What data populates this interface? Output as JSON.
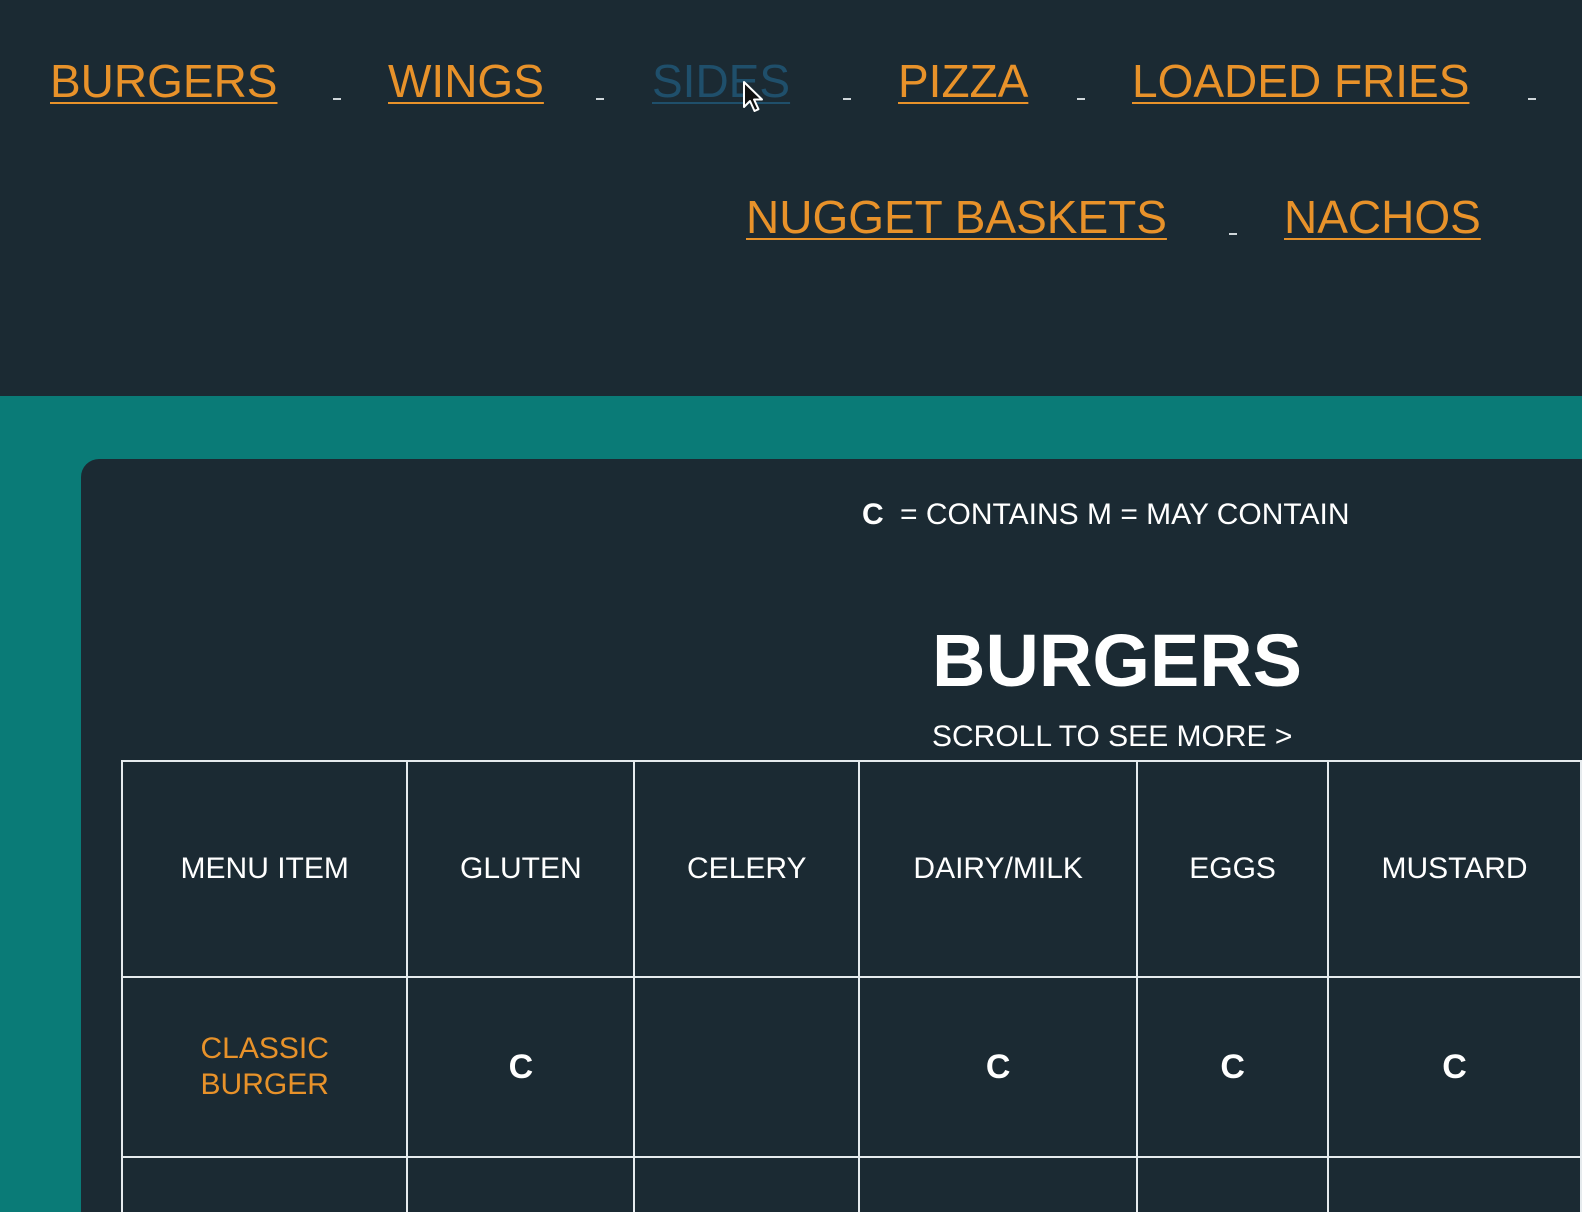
{
  "nav": {
    "links": [
      "BURGERS",
      "WINGS",
      "SIDES",
      "PIZZA",
      "LOADED FRIES",
      "NUGGET BASKETS",
      "NACHOS"
    ]
  },
  "legend": {
    "code": "C",
    "text": "= CONTAINS M = MAY CONTAIN"
  },
  "section": {
    "title": "BURGERS",
    "scroll_hint": "SCROLL TO SEE MORE >"
  },
  "table": {
    "headers": [
      "MENU ITEM",
      "GLUTEN",
      "CELERY",
      "DAIRY/MILK",
      "EGGS",
      "MUSTARD"
    ],
    "rows": [
      {
        "item_line1": "CLASSIC",
        "item_line2": "BURGER",
        "cells": [
          "C",
          "",
          "C",
          "C",
          "C"
        ]
      }
    ]
  },
  "colors": {
    "background": "#1b2a33",
    "accent_orange": "#e8922a",
    "teal": "#0a7b77",
    "hover_link": "#1f4f6b"
  },
  "icons": [
    "mouse-cursor-icon"
  ]
}
